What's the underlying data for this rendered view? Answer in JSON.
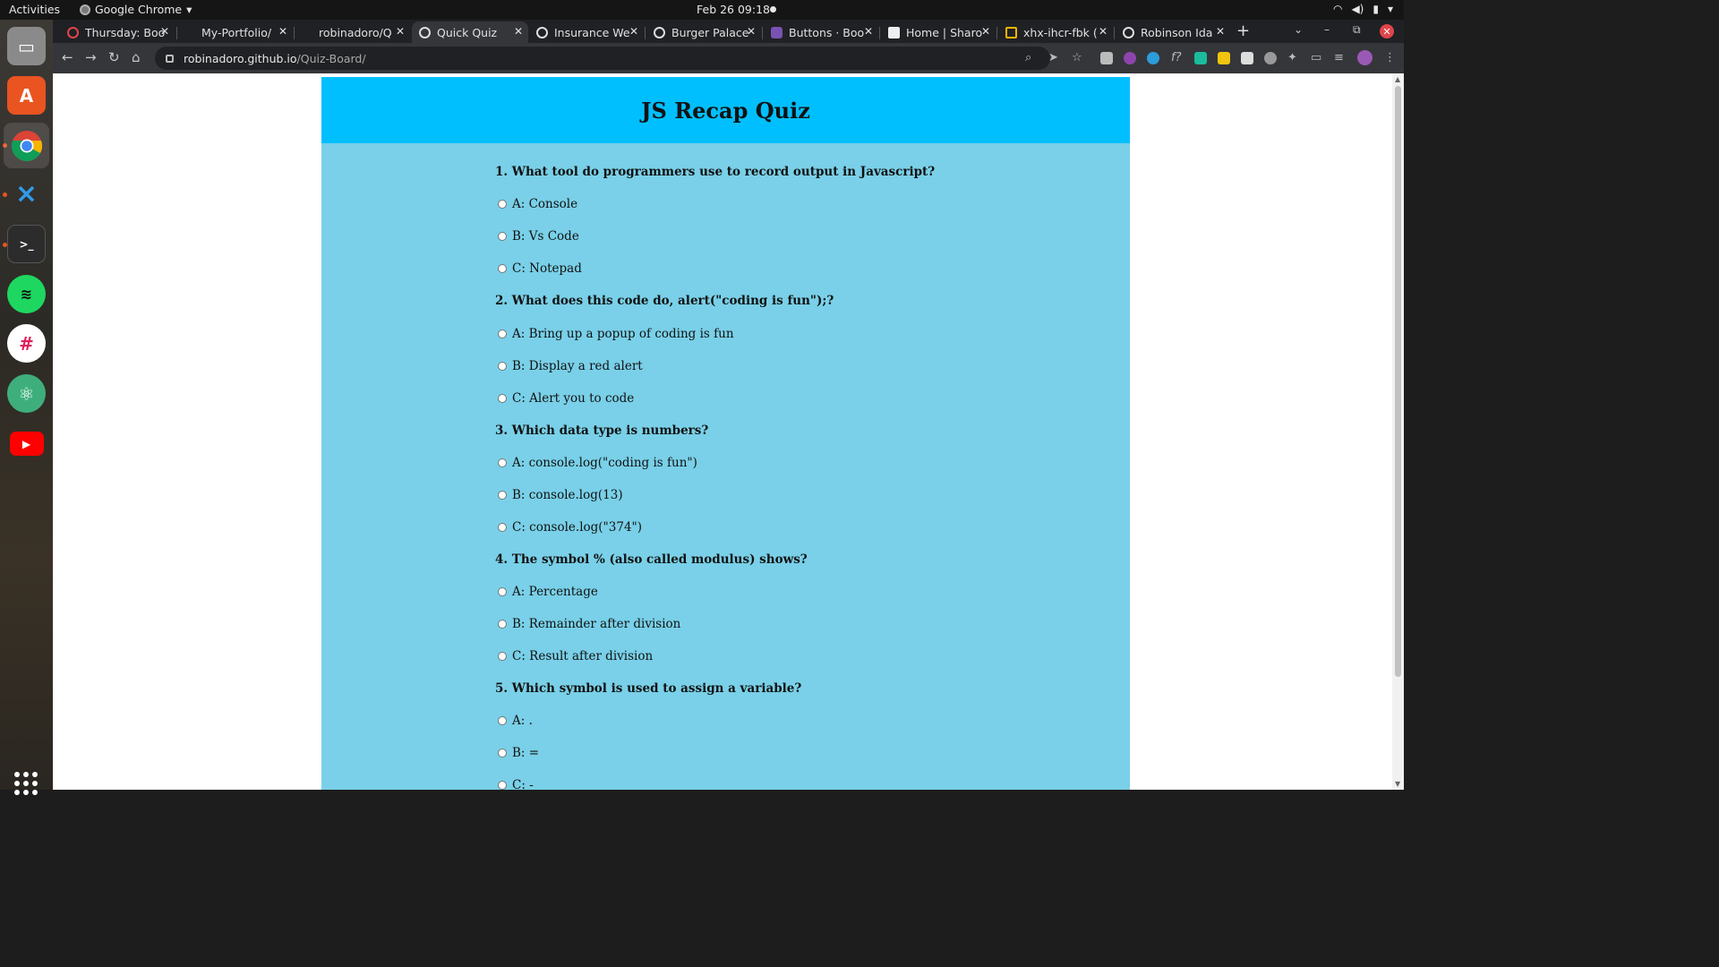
{
  "topbar": {
    "activities": "Activities",
    "app_name": "Google Chrome",
    "clock": "Feb 26  09:18"
  },
  "dock": {
    "items": [
      "files-icon",
      "app-store-icon",
      "chrome-icon",
      "vscode-icon",
      "terminal-icon",
      "spotify-icon",
      "slack-icon",
      "atom-icon",
      "youtube-icon"
    ]
  },
  "browser": {
    "tabs": [
      {
        "title": "Thursday: Boo"
      },
      {
        "title": "My-Portfolio/"
      },
      {
        "title": "robinadoro/Q"
      },
      {
        "title": "Quick Quiz"
      },
      {
        "title": "Insurance We"
      },
      {
        "title": "Burger Palace"
      },
      {
        "title": "Buttons · Boo"
      },
      {
        "title": "Home | Sharo"
      },
      {
        "title": "xhx-ihcr-fbk ("
      },
      {
        "title": "Robinson Ida"
      }
    ],
    "url_host": "robinadoro.github.io",
    "url_path": "/Quiz-Board/"
  },
  "quiz": {
    "title": "JS Recap Quiz",
    "questions": [
      {
        "text": "1. What tool do programmers use to record output in Javascript?",
        "options": [
          "A: Console",
          "B: Vs Code",
          "C: Notepad"
        ]
      },
      {
        "text": "2. What does this code do, alert(\"coding is fun\");?",
        "options": [
          "A: Bring up a popup of coding is fun",
          "B: Display a red alert",
          "C: Alert you to code"
        ]
      },
      {
        "text": "3. Which data type is numbers?",
        "options": [
          "A: console.log(\"coding is fun\")",
          "B: console.log(13)",
          "C: console.log(\"374\")"
        ]
      },
      {
        "text": "4. The symbol % (also called modulus) shows?",
        "options": [
          "A: Percentage",
          "B: Remainder after division",
          "C: Result after division"
        ]
      },
      {
        "text": "5. Which symbol is used to assign a variable?",
        "options": [
          "A: .",
          "B: =",
          "C: -"
        ]
      }
    ]
  }
}
